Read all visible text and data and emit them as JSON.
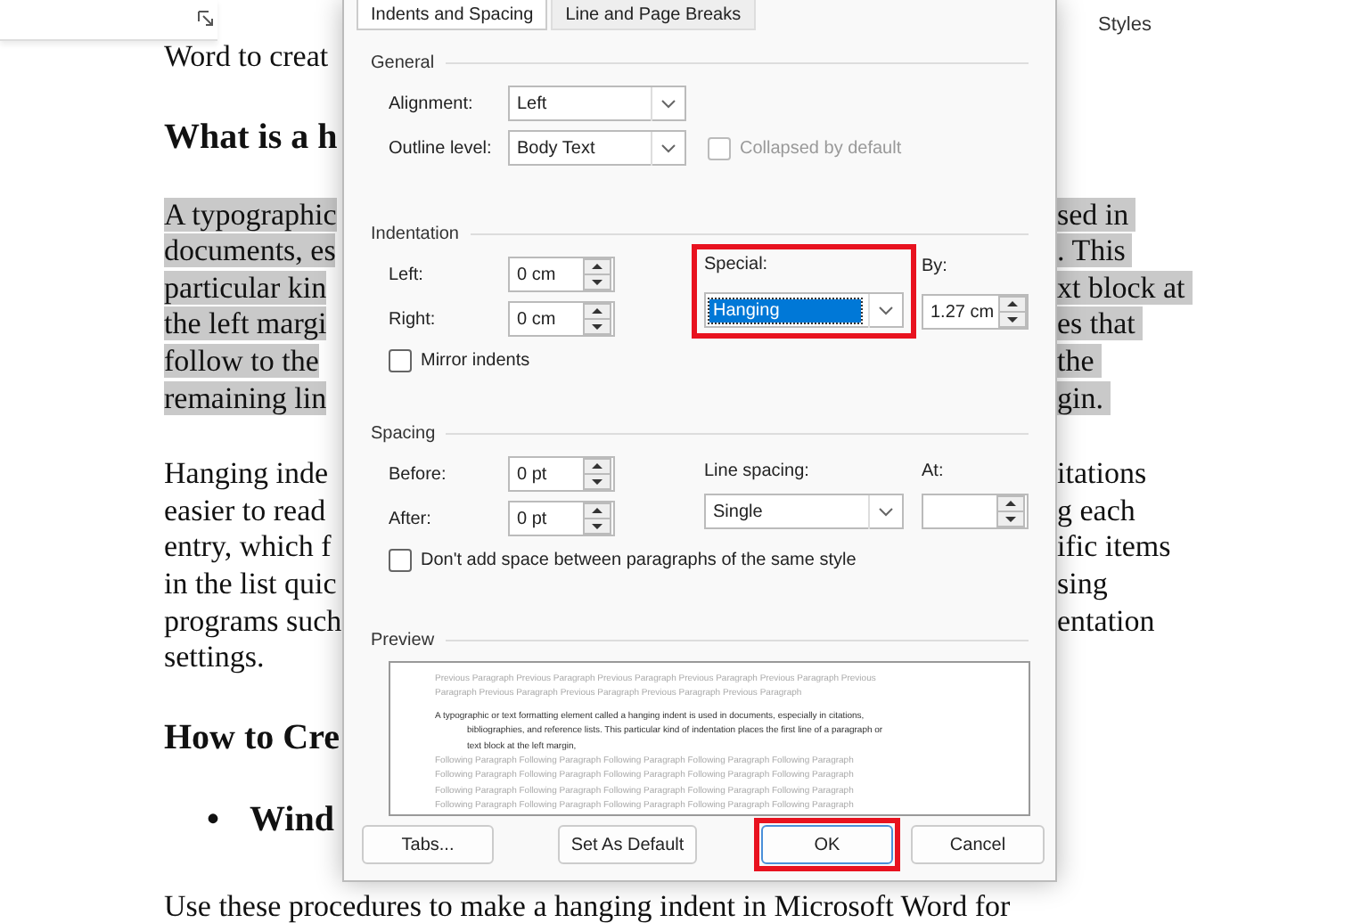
{
  "ribbon": {
    "label": "Styles"
  },
  "document": {
    "blocks": [
      {
        "kind": "paragraph",
        "lines": [
          {
            "left": "Word to creat"
          }
        ]
      },
      {
        "kind": "heading",
        "lines": [
          {
            "left": "What is a h"
          }
        ]
      },
      {
        "kind": "paragraph",
        "highlighted": true,
        "lines": [
          {
            "left": "A typographic",
            "right": "sed in"
          },
          {
            "left": "documents, es",
            "right": ". This"
          },
          {
            "left": "particular kin",
            "right": "xt block at"
          },
          {
            "left": "the left margi",
            "right": "es that"
          },
          {
            "left": "follow to the",
            "right": "the"
          },
          {
            "left": "remaining lin",
            "right": "gin."
          }
        ]
      },
      {
        "kind": "paragraph",
        "lines": [
          {
            "left": "Hanging inde",
            "right": "itations"
          },
          {
            "left": "easier to read",
            "right": "g each"
          },
          {
            "left": "entry, which f",
            "right": "ific items"
          },
          {
            "left": "in the list quic",
            "right": "sing"
          },
          {
            "left": "programs such",
            "right": "entation"
          },
          {
            "left": "settings."
          }
        ]
      },
      {
        "kind": "heading",
        "lines": [
          {
            "left": "How to Cre"
          }
        ]
      },
      {
        "kind": "bullet",
        "bullet": "•",
        "lines": [
          {
            "left": "Wind"
          }
        ]
      },
      {
        "kind": "paragraph",
        "lines": [
          {
            "full": "Use these procedures to make a hanging indent in Microsoft Word for"
          }
        ]
      }
    ]
  },
  "dialog": {
    "tabs": [
      {
        "label": "Indents and Spacing",
        "selected": true
      },
      {
        "label": "Line and Page Breaks",
        "selected": false
      }
    ],
    "general": {
      "title": "General",
      "alignment": {
        "label": "Alignment:",
        "value": "Left"
      },
      "outline_level": {
        "label": "Outline level:",
        "value": "Body Text"
      },
      "collapsed": {
        "label": "Collapsed by default",
        "checked": false,
        "disabled": true
      }
    },
    "indentation": {
      "title": "Indentation",
      "left": {
        "label": "Left:",
        "value": "0 cm"
      },
      "right": {
        "label": "Right:",
        "value": "0 cm"
      },
      "special": {
        "label": "Special:",
        "value": "Hanging",
        "highlighted": true
      },
      "by": {
        "label": "By:",
        "value": "1.27 cm"
      },
      "mirror": {
        "label": "Mirror indents",
        "checked": false
      }
    },
    "spacing": {
      "title": "Spacing",
      "before": {
        "label": "Before:",
        "value": "0 pt"
      },
      "after": {
        "label": "After:",
        "value": "0 pt"
      },
      "line_spacing": {
        "label": "Line spacing:",
        "value": "Single"
      },
      "at": {
        "label": "At:"
      },
      "dont_add": {
        "label": "Don't add space between paragraphs of the same style",
        "checked": false
      }
    },
    "preview": {
      "title": "Preview",
      "previous_lines": [
        "Previous Paragraph Previous Paragraph Previous Paragraph Previous Paragraph Previous Paragraph Previous",
        "Paragraph Previous Paragraph Previous Paragraph Previous Paragraph Previous Paragraph"
      ],
      "sample_lines": [
        "A typographic or text formatting element called a hanging indent is used in documents, especially in citations,",
        "bibliographies, and reference lists. This particular kind of indentation places the first line of a paragraph or",
        "text block at the left margin,"
      ],
      "following_lines": [
        "Following Paragraph Following Paragraph Following Paragraph Following Paragraph Following Paragraph",
        "Following Paragraph Following Paragraph Following Paragraph Following Paragraph Following Paragraph",
        "Following Paragraph Following Paragraph Following Paragraph Following Paragraph Following Paragraph",
        "Following Paragraph Following Paragraph Following Paragraph Following Paragraph Following Paragraph"
      ]
    },
    "buttons": [
      {
        "label": "Tabs...",
        "highlighted": false
      },
      {
        "label": "Set As Default",
        "highlighted": false
      },
      {
        "label": "OK",
        "highlighted": true
      },
      {
        "label": "Cancel",
        "highlighted": false
      }
    ]
  }
}
